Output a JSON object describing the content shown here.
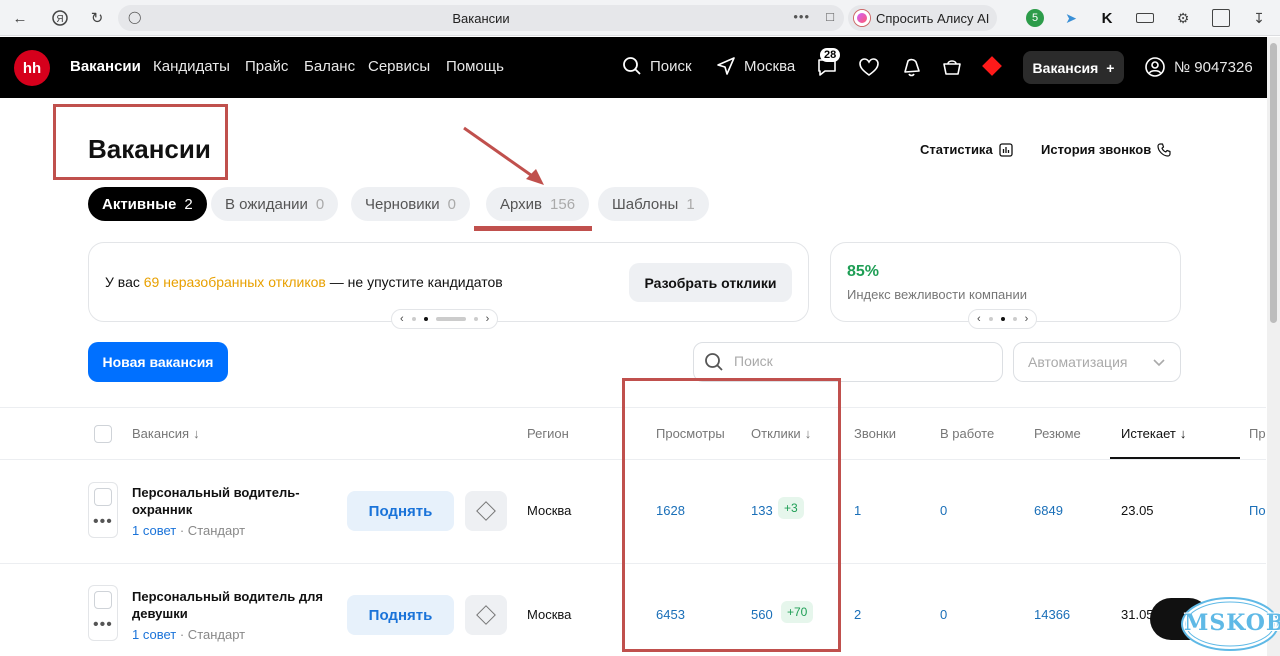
{
  "browser": {
    "title": "Вакансии",
    "alice_label": "Спросить Алису AI"
  },
  "nav": {
    "logo": "hh",
    "links": [
      "Вакансии",
      "Кандидаты",
      "Прайс",
      "Баланс",
      "Сервисы",
      "Помощь"
    ],
    "search": "Поиск",
    "city": "Москва",
    "messages_count": "28",
    "vacancy_button": "Вакансия",
    "account": "№ 9047326"
  },
  "page": {
    "title": "Вакансии",
    "stats_link": "Статистика",
    "calls_link": "История звонков"
  },
  "tabs": [
    {
      "label": "Активные",
      "count": "2"
    },
    {
      "label": "В ожидании",
      "count": "0"
    },
    {
      "label": "Черновики",
      "count": "0"
    },
    {
      "label": "Архив",
      "count": "156"
    },
    {
      "label": "Шаблоны",
      "count": "1"
    }
  ],
  "banner": {
    "prefix": "У вас",
    "highlight": "69 неразобранных откликов",
    "suffix": "— не упустите кандидатов",
    "button": "Разобрать отклики"
  },
  "politeness": {
    "percent": "85%",
    "label": "Индекс вежливости компании"
  },
  "controls": {
    "new_vacancy": "Новая вакансия",
    "search_placeholder": "Поиск",
    "automation": "Автоматизация"
  },
  "table": {
    "headers": {
      "vacancy": "Вакансия",
      "region": "Регион",
      "views": "Просмотры",
      "responses": "Отклики",
      "calls": "Звонки",
      "in_work": "В работе",
      "resume": "Резюме",
      "expires": "Истекает",
      "next": "Пр"
    },
    "rows": [
      {
        "name": "Персональный водитель-охранник",
        "advice": "1 совет",
        "tier": "· Стандарт",
        "raise": "Поднять",
        "region": "Москва",
        "views": "1628",
        "responses": "133",
        "responses_new": "+3",
        "calls": "1",
        "in_work": "0",
        "resume": "6849",
        "expires": "23.05",
        "next": "По"
      },
      {
        "name": "Персональный водитель для девушки",
        "advice": "1 совет",
        "tier": "· Стандарт",
        "raise": "Поднять",
        "region": "Москва",
        "views": "6453",
        "responses": "560",
        "responses_new": "+70",
        "calls": "2",
        "in_work": "0",
        "resume": "14366",
        "expires": "31.05"
      }
    ]
  },
  "watermark": "MSKOB",
  "colors": {
    "brand_red": "#d6001c",
    "primary_blue": "#0070ff",
    "annotation": "#c0504d",
    "positive_green": "#1e9e55",
    "highlight_orange": "#e8a000"
  }
}
